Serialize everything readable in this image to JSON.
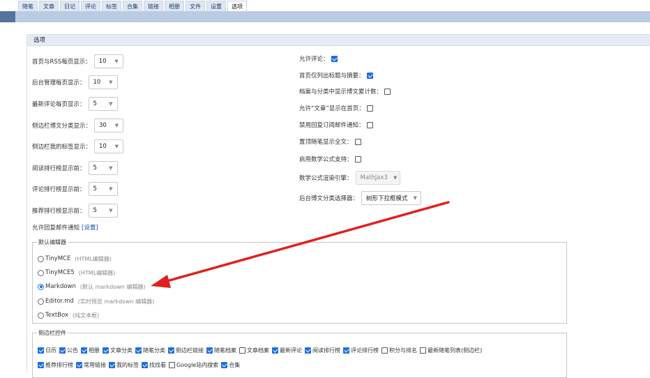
{
  "tabs": [
    "随笔",
    "文章",
    "日记",
    "评论",
    "标签",
    "合集",
    "链接",
    "相册",
    "文件",
    "设置",
    "选项"
  ],
  "active_tab": "选项",
  "panel_title": "选项",
  "left_settings": [
    {
      "label": "首页与RSS每页显示：",
      "value": "10"
    },
    {
      "label": "后台管理每页显示：",
      "value": "10"
    },
    {
      "label": "最新评论每页显示：",
      "value": "5"
    },
    {
      "label": "侧边栏博文分类显示：",
      "value": "30"
    },
    {
      "label": "侧边栏我的标签显示：",
      "value": "10"
    },
    {
      "label": "阅读排行榜显示前：",
      "value": "5"
    },
    {
      "label": "评论排行榜显示前：",
      "value": "5"
    },
    {
      "label": "推荐排行榜显示前：",
      "value": "5"
    }
  ],
  "reply_notify": {
    "label": "允许回复邮件通知",
    "link": "[设置]"
  },
  "right_settings": [
    {
      "label": "允许评论：",
      "checked": true
    },
    {
      "label": "首页仅列出标题与摘要：",
      "checked": true
    },
    {
      "label": "档案与分类中显示博文累计数：",
      "checked": false
    },
    {
      "label": "允许“文章”显示在首页：",
      "checked": false
    },
    {
      "label": "禁用回复订阅邮件通知：",
      "checked": false
    },
    {
      "label": "置顶随笔显示全文：",
      "checked": false
    },
    {
      "label": "启用数学公式支持：",
      "checked": false
    }
  ],
  "math_engine": {
    "label": "数学公式渲染引擎：",
    "value": "MathJax3"
  },
  "category_selector": {
    "label": "后台博文分类选择器：",
    "value": "树形下拉框模式"
  },
  "editor": {
    "legend": "默认编辑器",
    "options": [
      {
        "name": "TinyMCE",
        "hint": "(HTML编辑器)",
        "selected": false
      },
      {
        "name": "TinyMCE5",
        "hint": "(HTML编辑器)",
        "selected": false
      },
      {
        "name": "Markdown",
        "hint": "(默认 markdown 编辑器)",
        "selected": true
      },
      {
        "name": "Editor.md",
        "hint": "(实时预览 markdown 编辑器)",
        "selected": false
      },
      {
        "name": "TextBox",
        "hint": "(纯文本框)",
        "selected": false
      }
    ]
  },
  "widgets": {
    "legend": "侧边栏控件",
    "row1": [
      {
        "label": "日历",
        "checked": true
      },
      {
        "label": "公告",
        "checked": true
      },
      {
        "label": "相册",
        "checked": true
      },
      {
        "label": "文章分类",
        "checked": true
      },
      {
        "label": "随笔分类",
        "checked": true
      },
      {
        "label": "侧边栏链接",
        "checked": true
      },
      {
        "label": "随笔档案",
        "checked": true
      },
      {
        "label": "文章档案",
        "checked": false
      },
      {
        "label": "最新评论",
        "checked": true
      },
      {
        "label": "阅读排行榜",
        "checked": true
      },
      {
        "label": "评论排行榜",
        "checked": true
      },
      {
        "label": "积分与排名",
        "checked": false
      },
      {
        "label": "最新随笔列表(侧边栏)",
        "checked": false
      }
    ],
    "row2": [
      {
        "label": "推荐排行榜",
        "checked": true
      },
      {
        "label": "常用链接",
        "checked": true
      },
      {
        "label": "我的标签",
        "checked": true
      },
      {
        "label": "找找看",
        "checked": true
      },
      {
        "label": "Google站内搜索",
        "checked": false
      },
      {
        "label": "合集",
        "checked": true
      }
    ]
  },
  "colors": {
    "accent": "#1f6fe0",
    "annotation_arrow": "#e02020",
    "header_bar": "#bccbe3"
  }
}
